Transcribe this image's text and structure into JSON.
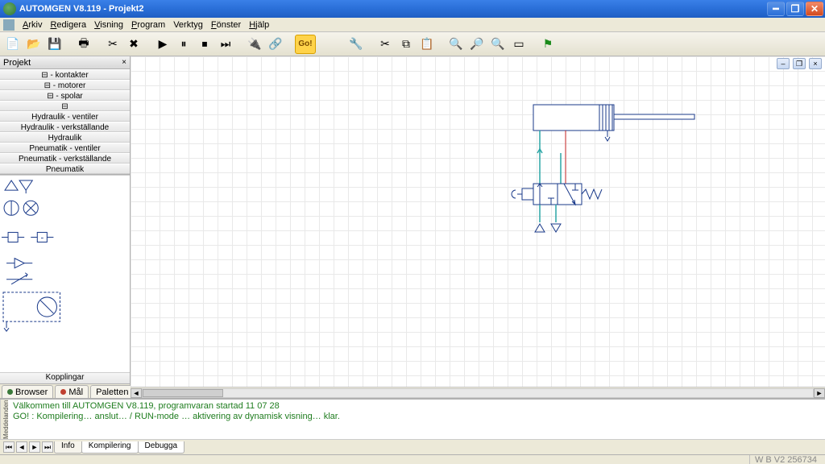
{
  "titlebar": {
    "title": "AUTOMGEN V8.119 - Projekt2"
  },
  "menu": {
    "items": [
      "Arkiv",
      "Redigera",
      "Visning",
      "Program",
      "Verktyg",
      "Fönster",
      "Hjälp"
    ]
  },
  "toolbar": {
    "go_label": "Go!"
  },
  "left_panel": {
    "header": "Projekt",
    "tree": [
      "⊟ - kontakter",
      "⊟ - motorer",
      "⊟ - spolar",
      "⊟",
      "Hydraulik - ventiler",
      "Hydraulik - verkställande",
      "Hydraulik",
      "Pneumatik - ventiler",
      "Pneumatik - verkställande",
      "Pneumatik"
    ],
    "palette_footer": "Kopplingar",
    "tabs": [
      {
        "label": "Browser",
        "color": "#3a7a3a"
      },
      {
        "label": "Mål",
        "color": "#c04030"
      },
      {
        "label": "Paletten",
        "color": ""
      }
    ]
  },
  "messages": {
    "side_label": "Meddelanden",
    "lines": [
      "Välkommen till AUTOMGEN V8.119, programvaran startad 11 07 28",
      "GO! : Kompilering… anslut… / RUN-mode … aktivering av dynamisk visning… klar."
    ],
    "tabs": [
      "Info",
      "Kompilering",
      "Debugga"
    ]
  },
  "statusbar": {
    "right": "W  B V2 256734"
  }
}
